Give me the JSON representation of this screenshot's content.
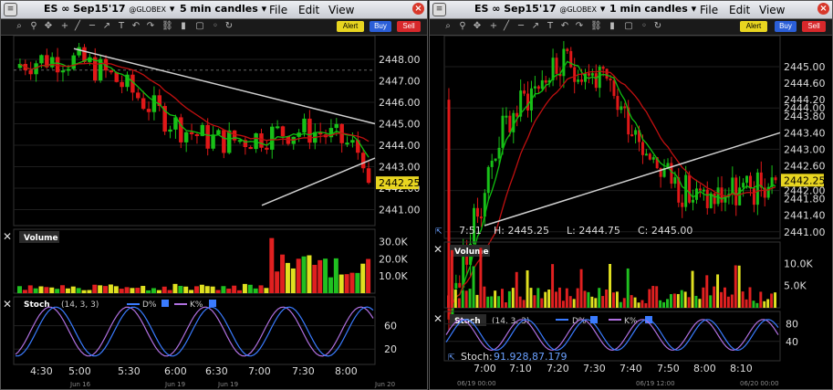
{
  "left": {
    "title_symbol": "ES ∞ Sep15'17",
    "exchange": "@GLOBEX",
    "interval": "5 min candles",
    "menu": [
      "File",
      "Edit",
      "View"
    ],
    "buttons": {
      "alert": "Alert",
      "buy": "Buy",
      "sell": "Sell"
    },
    "price_ticks": [
      "2448.00",
      "2447.00",
      "2446.00",
      "2445.00",
      "2444.00",
      "2443.00",
      "2442.00",
      "2441.00"
    ],
    "last_price": "2442.25",
    "volume": {
      "title": "Volume",
      "ticks": [
        "30.0K",
        "20.0K",
        "10.0K"
      ]
    },
    "stoch": {
      "title": "Stoch",
      "params": "(14, 3, 3)",
      "d_label": "D%",
      "k_label": "K%",
      "ticks": [
        "60",
        "20"
      ]
    },
    "time_ticks": [
      "4:30",
      "5:00",
      "5:30",
      "6:00",
      "6:30",
      "7:00",
      "7:30",
      "8:00"
    ],
    "date_ticks": [
      "Jun 16",
      "Jun 19",
      "Jun 19",
      "Jun 20"
    ]
  },
  "right": {
    "title_symbol": "ES ∞ Sep15'17",
    "exchange": "@GLOBEX",
    "interval": "1 min candles",
    "menu": [
      "File",
      "Edit",
      "View"
    ],
    "buttons": {
      "alert": "Alert",
      "buy": "Buy",
      "sell": "Sell"
    },
    "price_ticks": [
      "2445.00",
      "2444.00",
      "2443.00",
      "2442.00",
      "2441.00"
    ],
    "price_ticks_mid": [
      "2444.60",
      "2444.20",
      "2443.80",
      "2443.40",
      "2442.60",
      "2441.80",
      "2441.40"
    ],
    "last_price": "2442.25",
    "ohlc": {
      "time": "7:51",
      "h": "H: 2445.25",
      "l": "L: 2444.75",
      "c": "C: 2445.00"
    },
    "volume": {
      "title": "Volume",
      "ticks": [
        "10.0K",
        "5.0K"
      ]
    },
    "stoch": {
      "title": "Stoch",
      "params": "(14, 3, 3)",
      "d_label": "D%",
      "k_label": "K%",
      "ticks": [
        "80",
        "40"
      ],
      "readout_label": "Stoch:",
      "readout_value": "91.928,87.179"
    },
    "time_ticks": [
      "7:00",
      "7:10",
      "7:20",
      "7:30",
      "7:40",
      "7:50",
      "8:00",
      "8:10"
    ],
    "date_ticks": [
      "06/19 00:00",
      "06/19 12:00",
      "06/20 00:00"
    ]
  },
  "colors": {
    "up": "#18c018",
    "down": "#e01818",
    "ma_fast": "#10c010",
    "ma_slow": "#c01010",
    "trend": "#d0d0d0",
    "d_line": "#3a7bff",
    "k_line": "#b070e0",
    "vol_up": "#20c020",
    "vol_down": "#e02020",
    "vol_neutral": "#e0e020",
    "last_bg": "#e8d520"
  }
}
